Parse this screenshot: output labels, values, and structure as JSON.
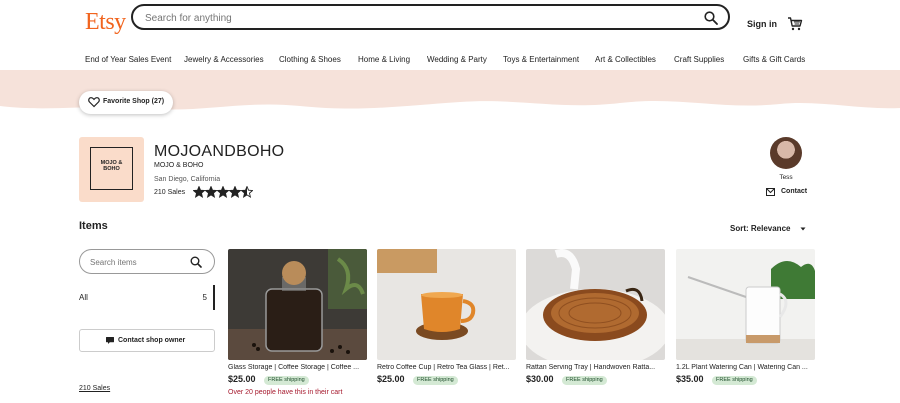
{
  "header": {
    "logo": "Etsy",
    "search_placeholder": "Search for anything",
    "signin": "Sign in"
  },
  "nav": [
    "End of Year Sales Event",
    "Jewelry & Accessories",
    "Clothing & Shoes",
    "Home & Living",
    "Wedding & Party",
    "Toys & Entertainment",
    "Art & Collectibles",
    "Craft Supplies",
    "Gifts & Gift Cards"
  ],
  "favorite_button": "Favorite Shop (27)",
  "shop": {
    "logo_text_line1": "MOJO &",
    "logo_text_line2": "BOHO",
    "name": "MOJOANDBOHO",
    "subtitle": "MOJO & BOHO",
    "location": "San Diego, California",
    "sales": "210 Sales",
    "rating": 4.5
  },
  "owner": {
    "name": "Tess",
    "contact": "Contact"
  },
  "items_heading": "Items",
  "sort_label": "Sort: Relevance",
  "sidebar": {
    "search_placeholder": "Search items",
    "all_label": "All",
    "all_count": "5",
    "contact_owner": "Contact shop owner",
    "sales_link": "210 Sales"
  },
  "products": [
    {
      "title": "Glass Storage | Coffee Storage | Coffee ...",
      "price": "$25.00",
      "shipping": "FREE shipping",
      "note": "Over 20 people have this in their cart"
    },
    {
      "title": "Retro Coffee Cup | Retro Tea Glass | Ret...",
      "price": "$25.00",
      "shipping": "FREE shipping",
      "note": ""
    },
    {
      "title": "Rattan Serving Tray | Handwoven Ratta...",
      "price": "$30.00",
      "shipping": "FREE shipping",
      "note": ""
    },
    {
      "title": "1.2L Plant Watering Can | Watering Can ...",
      "price": "$35.00",
      "shipping": "FREE shipping",
      "note": ""
    }
  ],
  "colors": {
    "brand": "#f1641e",
    "banner": "#f6e2da",
    "shipping_badge": "#d4e9d4",
    "note": "#a61a2e"
  }
}
